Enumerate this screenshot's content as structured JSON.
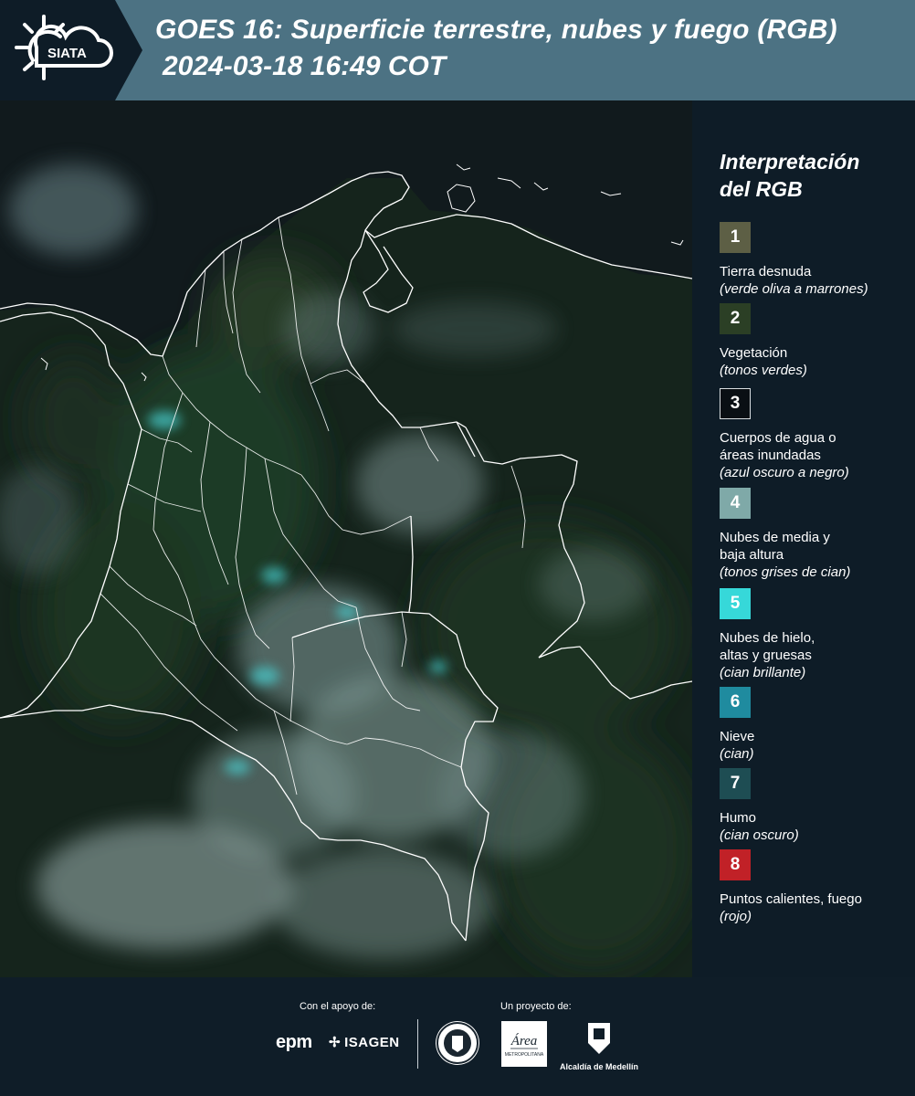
{
  "header": {
    "logo_text": "SIATA",
    "title": "GOES 16: Superficie terrestre, nubes y fuego (RGB)",
    "datetime": "2024-03-18 16:49 COT"
  },
  "legend": {
    "title_line1": "Interpretación",
    "title_line2": "del RGB",
    "items": [
      {
        "number": "1",
        "name": "Tierra desnuda",
        "note": "(verde oliva a marrones)",
        "color": "#5d5f45"
      },
      {
        "number": "2",
        "name": "Vegetación",
        "note": "(tonos verdes)",
        "color": "#2b3f25"
      },
      {
        "number": "3",
        "name": "Cuerpos de agua o áreas inundadas",
        "note": "(azul oscuro a negro)",
        "color": "#0a0f14"
      },
      {
        "number": "4",
        "name": "Nubes de media y baja altura",
        "note": "(tonos grises de cian)",
        "color": "#7fa9a8"
      },
      {
        "number": "5",
        "name": "Nubes de hielo, altas y gruesas",
        "note": "(cian brillante)",
        "color": "#36d8d9"
      },
      {
        "number": "6",
        "name": "Nieve",
        "note": "(cian)",
        "color": "#1f8b9f"
      },
      {
        "number": "7",
        "name": "Humo",
        "note": "(cian oscuro)",
        "color": "#1e4d53"
      },
      {
        "number": "8",
        "name": "Puntos calientes, fuego",
        "note": "(rojo)",
        "color": "#c12127"
      }
    ]
  },
  "footer": {
    "support_label": "Con el apoyo de:",
    "project_label": "Un proyecto de:",
    "sponsor1": "epm",
    "sponsor2": "ISAGEN",
    "area_text": "Área",
    "area_sub": "METROPOLITANA",
    "alcaldia": "Alcaldía de Medellín"
  },
  "colors": {
    "header_bg": "#4c7283",
    "panel_bg": "#0e1c27",
    "boundary": "#ffffff"
  }
}
